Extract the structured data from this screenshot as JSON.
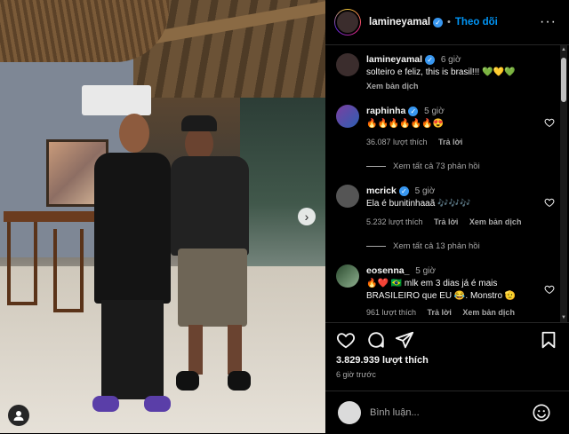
{
  "header": {
    "username": "lamineyamal",
    "follow_label": "Theo dõi",
    "separator": "•"
  },
  "caption": {
    "username": "lamineyamal",
    "time": "6 giờ",
    "text": "solteiro e feliz, this is brasil!!! 💚💛💚",
    "translate_label": "Xem bản dịch"
  },
  "comments": [
    {
      "username": "raphinha",
      "time": "5 giờ",
      "text": "🔥🔥🔥🔥🔥🔥😍",
      "likes": "36.087 lượt thích",
      "reply_label": "Trả lời",
      "translate_label": "",
      "view_replies": "Xem tất cả 73 phản hồi"
    },
    {
      "username": "mcrick",
      "time": "5 giờ",
      "text": "Ela é bunitinhaaã 🎶🎶🎶",
      "likes": "5.232 lượt thích",
      "reply_label": "Trả lời",
      "translate_label": "Xem bản dịch",
      "view_replies": "Xem tất cả 13 phản hồi"
    },
    {
      "username": "eosenna_",
      "time": "5 giờ",
      "text": "🔥❤️ 🇧🇷 mlk em 3 dias já é mais BRASILEIRO que EU 😂. Monstro 🫡",
      "likes": "961 lượt thích",
      "reply_label": "Trả lời",
      "translate_label": "Xem bản dịch",
      "view_replies": ""
    }
  ],
  "post": {
    "like_count": "3.829.939 lượt thích",
    "time_ago": "6 giờ trước",
    "comment_placeholder": "Bình luận..."
  },
  "icons": {
    "heart": "heart-icon",
    "comment": "comment-icon",
    "share": "share-icon",
    "save": "bookmark-icon",
    "emoji": "emoji-icon",
    "more": "more-icon",
    "next": "chevron-right-icon",
    "tag": "user-tag-icon"
  },
  "colors": {
    "follow": "#0095f6",
    "verified": "#3897f0",
    "background": "#000000"
  }
}
